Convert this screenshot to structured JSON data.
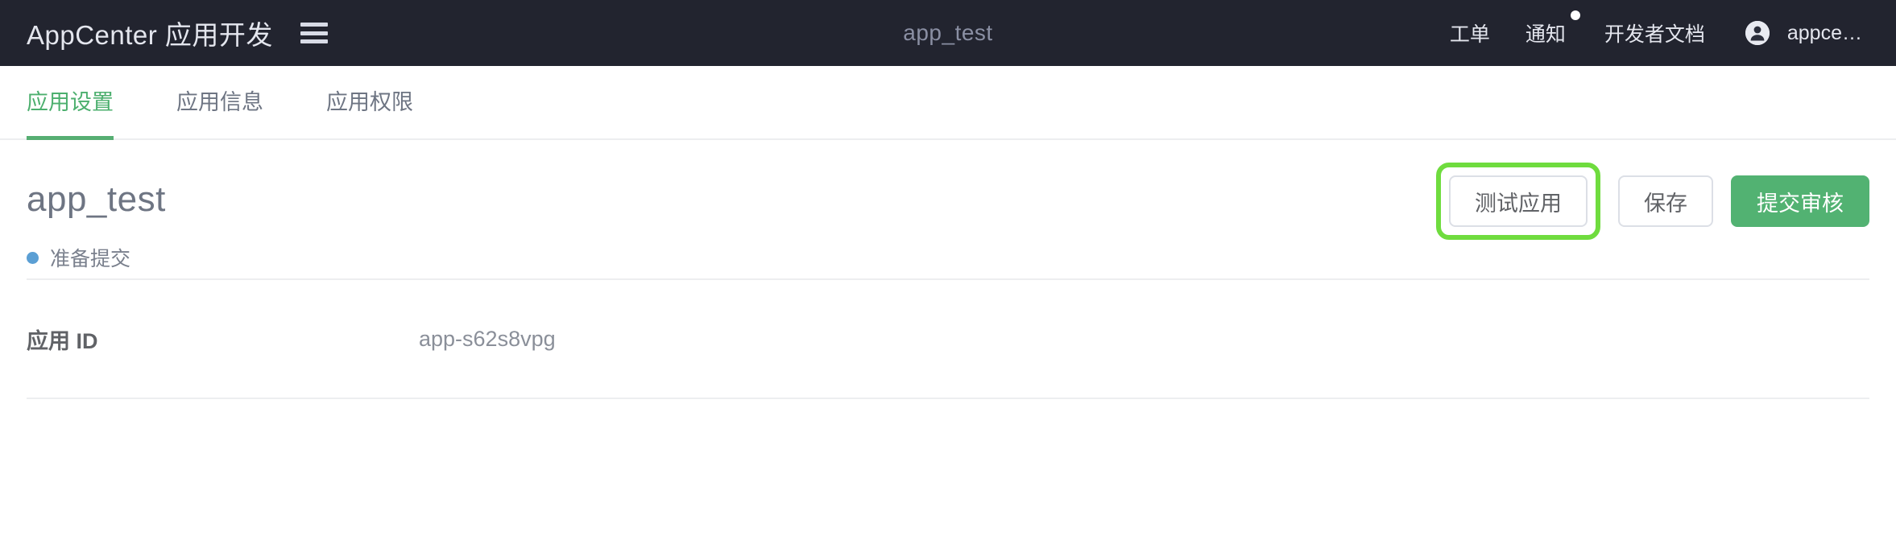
{
  "header": {
    "brand_title": "AppCenter 应用开发",
    "menu_icon": "hamburger-icon",
    "center_title": "app_test",
    "nav": [
      {
        "label": "工单",
        "icon": null,
        "badge": false
      },
      {
        "label": "通知",
        "icon": null,
        "badge": true
      },
      {
        "label": "开发者文档",
        "icon": null,
        "badge": false
      }
    ],
    "user": {
      "icon": "user-avatar-icon",
      "name": "appce…"
    },
    "background_color": "#22242F",
    "text_color": "#E4E6EE",
    "badge_color": "#FFFFFF"
  },
  "tabs": [
    {
      "label": "应用设置",
      "active": true
    },
    {
      "label": "应用信息",
      "active": false
    },
    {
      "label": "应用权限",
      "active": false
    }
  ],
  "tab_accent_color": "#56AE72",
  "page": {
    "title": "app_test",
    "status": {
      "label": "准备提交",
      "dot_color": "#5B9FD4"
    },
    "actions": [
      {
        "label": "测试应用",
        "style": "default",
        "highlighted": true
      },
      {
        "label": "保存",
        "style": "default",
        "highlighted": false
      },
      {
        "label": "提交审核",
        "style": "primary",
        "highlighted": false
      }
    ],
    "highlight_color": "#6FDC3E",
    "primary_color": "#52B272"
  },
  "info_rows": [
    {
      "label": "应用 ID",
      "value": "app-s62s8vpg"
    }
  ]
}
